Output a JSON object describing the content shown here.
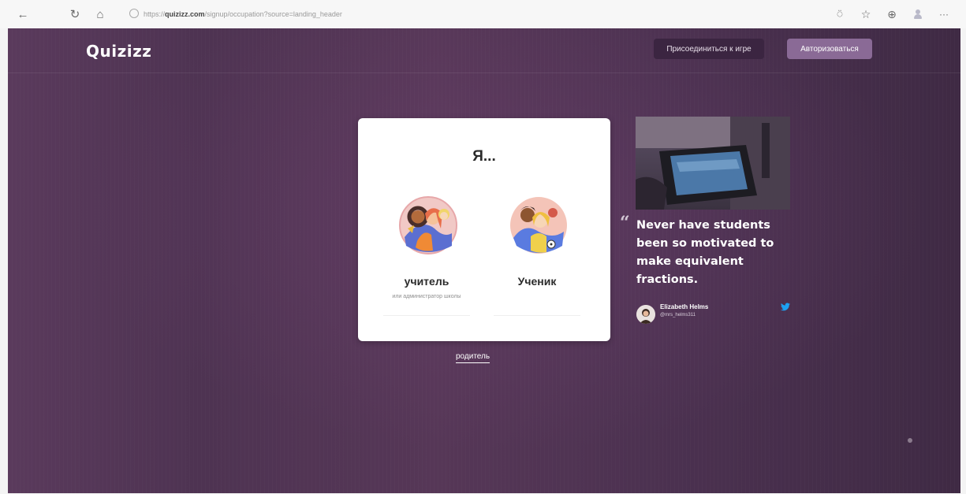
{
  "browser": {
    "url_prefix": "https://",
    "url_host": "quizizz.com",
    "url_path": "/signup/occupation?source=landing_header"
  },
  "header": {
    "logo": "Quizizz",
    "join_label": "Присоединиться к игре",
    "login_label": "Авторизоваться"
  },
  "card": {
    "title": "Я...",
    "roles": [
      {
        "label": "учитель",
        "sub": "или администратор школы"
      },
      {
        "label": "Ученик",
        "sub": ""
      }
    ],
    "parent_label": "родитель"
  },
  "testimonial": {
    "quote_mark": "“",
    "quote": "Never have students been so motivated to make equivalent fractions.",
    "author_name": "Elizabeth Helms",
    "author_handle": "@mrs_helms311"
  },
  "colors": {
    "page_bg": "#4e3352",
    "login_button": "#8a6a96",
    "join_button": "#3b2541",
    "twitter": "#1da1f2"
  }
}
